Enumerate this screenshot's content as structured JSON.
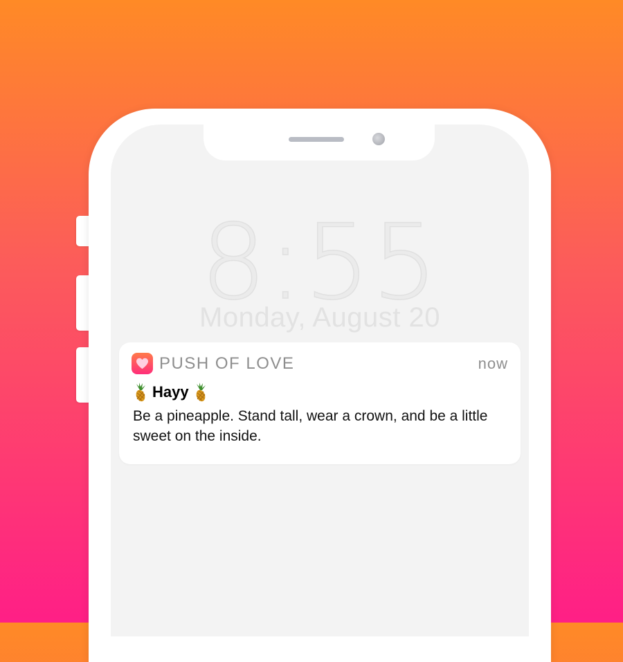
{
  "lock_screen": {
    "time": "8:55",
    "date": "Monday, August 20"
  },
  "notification": {
    "app_icon": "heart-icon",
    "app_name": "PUSH OF LOVE",
    "timestamp": "now",
    "title": "Hayy",
    "title_emoji": "pineapple-icon",
    "body": "Be a pineapple. Stand tall, wear a crown, and be a little sweet on the inside."
  },
  "colors": {
    "background_top": "#ff8a26",
    "background_bottom": "#ff1f86",
    "app_icon_top": "#ff7a4a",
    "app_icon_bottom": "#ff2e7a"
  }
}
